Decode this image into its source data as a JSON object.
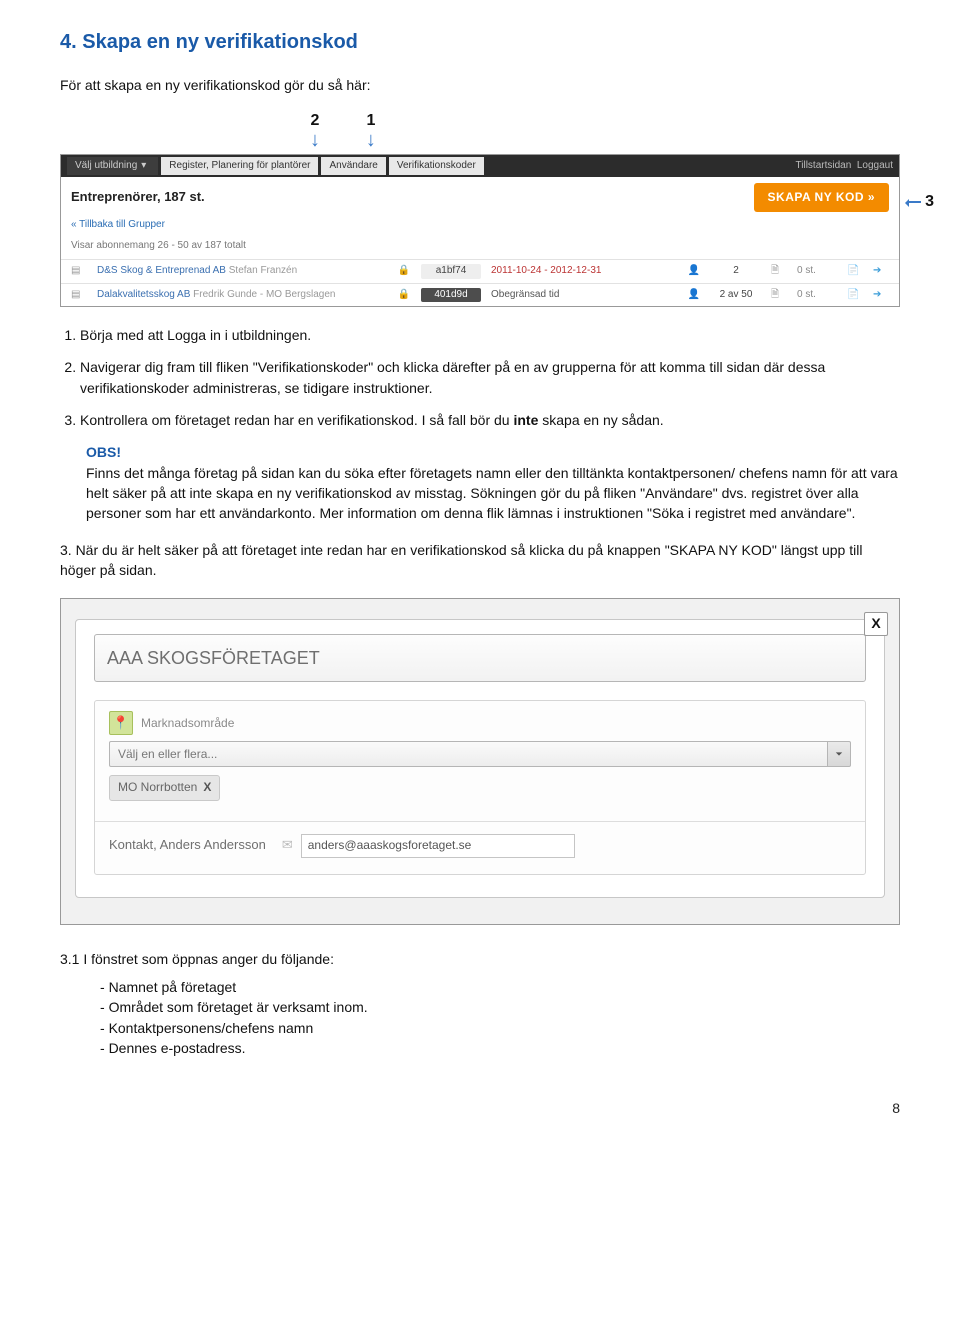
{
  "section": {
    "title": "4. Skapa en ny verifikationskod",
    "intro": "För att skapa en ny verifikationskod gör du så här:"
  },
  "arrows": {
    "left_num": "2",
    "right_num": "1",
    "side_num": "3"
  },
  "shot1": {
    "nav": {
      "tab1": "Välj utbildning",
      "tab2": "Register, Planering för plantörer",
      "tab3": "Användare",
      "tab4": "Verifikationskoder",
      "right1": "Tillstartsidan",
      "right2": "Loggaut"
    },
    "title": "Entreprenörer, 187 st.",
    "back": "« Tillbaka till Grupper",
    "meta": "Visar abonnemang 26 - 50 av 187 totalt",
    "btn": "SKAPA NY KOD   »",
    "rows": [
      {
        "name": "D&S Skog & Entreprenad AB",
        "person": "Stefan Franzén",
        "code": "a1bf74",
        "code_dark": false,
        "date": "2011-10-24 - 2012-12-31",
        "n": "2",
        "cnt": "0 st."
      },
      {
        "name": "Dalakvalitetsskog AB",
        "person": "Fredrik Gunde - MO Bergslagen",
        "code": "401d9d",
        "code_dark": true,
        "date": "Obegränsad tid",
        "n": "2 av 50",
        "cnt": "0 st."
      }
    ]
  },
  "steps": {
    "s1": "Börja med att Logga in i utbildningen.",
    "s2": "Navigerar dig fram till fliken \"Verifikationskoder\" och klicka därefter på en av grupperna för att komma till sidan där dessa verifikationskoder administreras, se tidigare instruktioner.",
    "s3_a": "Kontrollera om företaget redan har en verifikationskod. I så fall bör du ",
    "s3_b_strong": "inte",
    "s3_c": " skapa en ny sådan."
  },
  "obs": {
    "title": "OBS!",
    "body": "Finns det många företag på sidan kan du söka efter företagets namn eller den tilltänkta kontaktpersonen/ chefens namn för att vara helt säker på att inte skapa en ny verifikationskod av misstag. Sökningen gör du på fliken \"Användare\" dvs. registret över alla personer som har ett användarkonto. Mer information om denna flik lämnas i instruktionen \"Söka i registret med användare\"."
  },
  "step3": "3. När du är helt säker på att företaget inte redan har en verifikationskod så klicka du på knappen \"SKAPA NY KOD\" längst upp till höger på sidan.",
  "dialog": {
    "close": "X",
    "company": "AAA SKOGSFÖRETAGET",
    "mkt_label": "Marknadsområde",
    "mkt_placeholder": "Välj en eller flera...",
    "chip": "MO Norrbotten",
    "contact_name": "Kontakt,  Anders Andersson",
    "contact_email": "anders@aaaskogsforetaget.se"
  },
  "after": {
    "lead": "3.1 I fönstret som öppnas anger du följande:",
    "items": [
      "Namnet på företaget",
      "Området som företaget är verksamt inom.",
      "Kontaktpersonens/chefens namn",
      "Dennes e-postadress."
    ]
  },
  "page_number": "8"
}
